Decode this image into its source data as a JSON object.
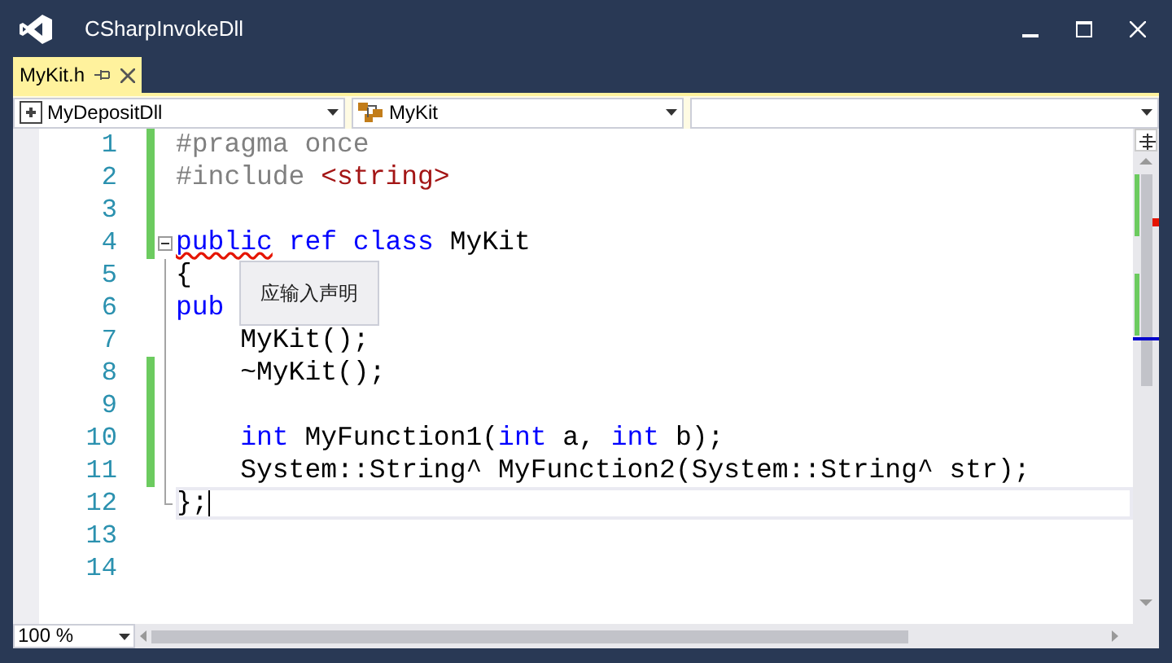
{
  "window": {
    "title": "CSharpInvokeDll"
  },
  "tabs": [
    {
      "label": "MyKit.h",
      "selected": true
    }
  ],
  "navigation": {
    "project": "MyDepositDll",
    "scope": "MyKit"
  },
  "editor": {
    "lines": [
      {
        "number": "1",
        "changed": true,
        "tokens": [
          {
            "kind": "preproc",
            "text": "#pragma once"
          }
        ]
      },
      {
        "number": "2",
        "changed": true,
        "tokens": [
          {
            "kind": "preproc",
            "text": "#include "
          },
          {
            "kind": "string",
            "text": "<string>"
          }
        ]
      },
      {
        "number": "3",
        "changed": true
      },
      {
        "number": "4",
        "changed": true,
        "fold_start": true,
        "tokens": [
          {
            "kind": "keyword",
            "text": "public",
            "error": true
          },
          {
            "kind": "keyword",
            "text": " ref class"
          },
          {
            "kind": "plain",
            "text": " MyKit"
          }
        ]
      },
      {
        "number": "5",
        "changed": false,
        "tokens": [
          {
            "kind": "plain",
            "text": "{"
          }
        ]
      },
      {
        "number": "6",
        "changed": false,
        "tokens": [
          {
            "kind": "keyword",
            "text": "pub"
          }
        ]
      },
      {
        "number": "7",
        "changed": false,
        "tokens": [
          {
            "kind": "plain",
            "text": "    MyKit();"
          }
        ]
      },
      {
        "number": "8",
        "changed": true,
        "tokens": [
          {
            "kind": "plain",
            "text": "    ~MyKit();"
          }
        ]
      },
      {
        "number": "9",
        "changed": true
      },
      {
        "number": "10",
        "changed": true,
        "tokens": [
          {
            "kind": "keyword",
            "text": "    int"
          },
          {
            "kind": "plain",
            "text": " MyFunction1("
          },
          {
            "kind": "keyword",
            "text": "int"
          },
          {
            "kind": "plain",
            "text": " a, "
          },
          {
            "kind": "keyword",
            "text": "int"
          },
          {
            "kind": "plain",
            "text": " b);"
          }
        ]
      },
      {
        "number": "11",
        "changed": true,
        "tokens": [
          {
            "kind": "plain",
            "text": "    System::String^ MyFunction2(System::String^ str);"
          }
        ]
      },
      {
        "number": "12",
        "changed": false,
        "current": true,
        "fold_end": true,
        "tokens": [
          {
            "kind": "plain",
            "text": "};"
          }
        ]
      },
      {
        "number": "13",
        "changed": false
      },
      {
        "number": "14",
        "changed": false
      }
    ],
    "tooltip": "应输入声明"
  },
  "zoom": "100 %"
}
